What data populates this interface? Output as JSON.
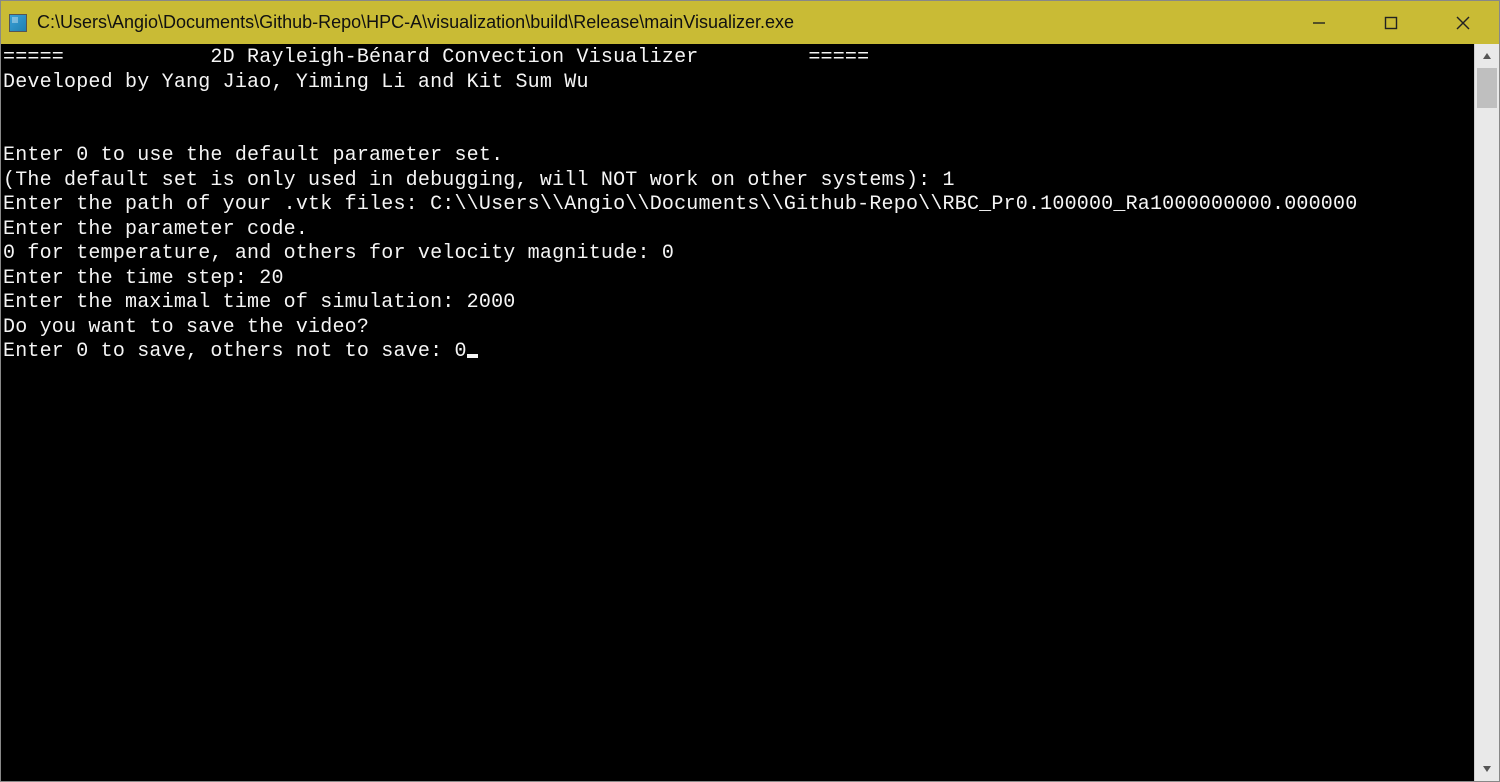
{
  "titlebar": {
    "title": "C:\\Users\\Angio\\Documents\\Github-Repo\\HPC-A\\visualization\\build\\Release\\mainVisualizer.exe"
  },
  "console": {
    "header_line": "=====            2D Rayleigh-Bénard Convection Visualizer         =====",
    "authors_line": "Developed by Yang Jiao, Yiming Li and Kit Sum Wu",
    "blank1": "",
    "blank2": "",
    "prompt_default_1": "Enter 0 to use the default parameter set.",
    "prompt_default_2": "(The default set is only used in debugging, will NOT work on other systems): 1",
    "prompt_path": "Enter the path of your .vtk files: C:\\\\Users\\\\Angio\\\\Documents\\\\Github-Repo\\\\RBC_Pr0.100000_Ra1000000000.000000",
    "prompt_param_code_1": "Enter the parameter code.",
    "prompt_param_code_2": "0 for temperature, and others for velocity magnitude: 0",
    "prompt_time_step": "Enter the time step: 20",
    "prompt_max_time": "Enter the maximal time of simulation: 2000",
    "prompt_save_1": "Do you want to save the video?",
    "prompt_save_2": "Enter 0 to save, others not to save: 0"
  }
}
